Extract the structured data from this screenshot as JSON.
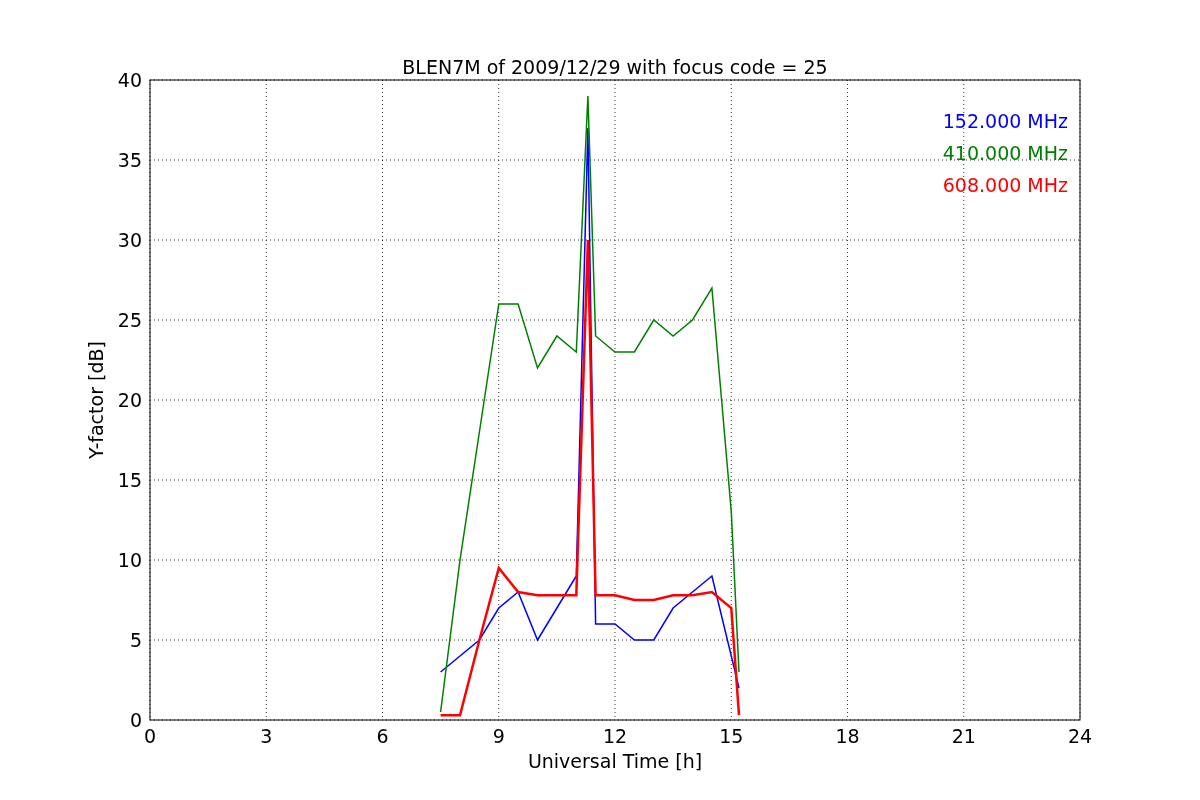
{
  "chart_data": {
    "type": "line",
    "title": "BLEN7M of 2009/12/29 with focus code = 25",
    "xlabel": "Universal Time [h]",
    "ylabel": "Y-factor [dB]",
    "x": [
      7.5,
      8,
      8.5,
      9,
      9.5,
      10,
      10.5,
      11,
      11.3,
      11.5,
      12,
      12.5,
      13,
      13.5,
      14,
      14.5,
      15,
      15.2
    ],
    "series": [
      {
        "name": "152.000 MHz",
        "color": "#0000ff",
        "values": [
          3,
          4,
          5,
          7,
          8,
          5,
          7,
          9,
          37,
          6,
          6,
          5,
          5,
          7,
          8,
          9,
          4,
          2
        ]
      },
      {
        "name": "410.000 MHz",
        "color": "#008000",
        "values": [
          0.5,
          10,
          18,
          26,
          26,
          22,
          24,
          23,
          39,
          24,
          23,
          23,
          25,
          24,
          25,
          27,
          13,
          3
        ]
      },
      {
        "name": "608.000 MHz",
        "color": "#ff0000",
        "values": [
          0.3,
          0.3,
          5,
          9.5,
          8,
          7.8,
          7.8,
          7.8,
          30,
          7.8,
          7.8,
          7.5,
          7.5,
          7.8,
          7.8,
          8,
          7,
          0.3
        ]
      }
    ],
    "xlim": [
      0,
      24
    ],
    "ylim": [
      0,
      40
    ],
    "xticks": [
      0,
      3,
      6,
      9,
      12,
      15,
      18,
      21,
      24
    ],
    "yticks": [
      0,
      5,
      10,
      15,
      20,
      25,
      30,
      35,
      40
    ],
    "grid": true
  }
}
